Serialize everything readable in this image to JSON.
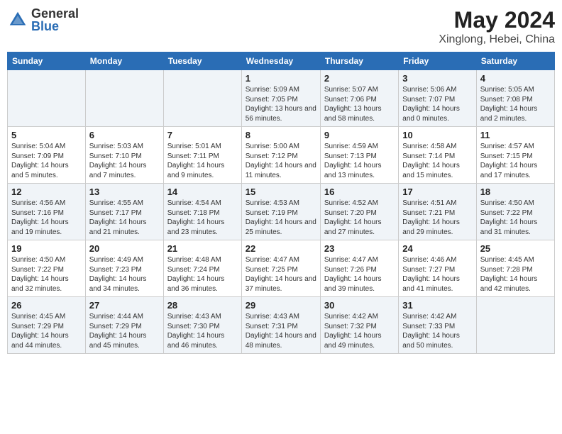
{
  "logo": {
    "general": "General",
    "blue": "Blue"
  },
  "header": {
    "month": "May 2024",
    "location": "Xinglong, Hebei, China"
  },
  "weekdays": [
    "Sunday",
    "Monday",
    "Tuesday",
    "Wednesday",
    "Thursday",
    "Friday",
    "Saturday"
  ],
  "weeks": [
    [
      {
        "day": "",
        "info": ""
      },
      {
        "day": "",
        "info": ""
      },
      {
        "day": "",
        "info": ""
      },
      {
        "day": "1",
        "info": "Sunrise: 5:09 AM\nSunset: 7:05 PM\nDaylight: 13 hours and 56 minutes."
      },
      {
        "day": "2",
        "info": "Sunrise: 5:07 AM\nSunset: 7:06 PM\nDaylight: 13 hours and 58 minutes."
      },
      {
        "day": "3",
        "info": "Sunrise: 5:06 AM\nSunset: 7:07 PM\nDaylight: 14 hours and 0 minutes."
      },
      {
        "day": "4",
        "info": "Sunrise: 5:05 AM\nSunset: 7:08 PM\nDaylight: 14 hours and 2 minutes."
      }
    ],
    [
      {
        "day": "5",
        "info": "Sunrise: 5:04 AM\nSunset: 7:09 PM\nDaylight: 14 hours and 5 minutes."
      },
      {
        "day": "6",
        "info": "Sunrise: 5:03 AM\nSunset: 7:10 PM\nDaylight: 14 hours and 7 minutes."
      },
      {
        "day": "7",
        "info": "Sunrise: 5:01 AM\nSunset: 7:11 PM\nDaylight: 14 hours and 9 minutes."
      },
      {
        "day": "8",
        "info": "Sunrise: 5:00 AM\nSunset: 7:12 PM\nDaylight: 14 hours and 11 minutes."
      },
      {
        "day": "9",
        "info": "Sunrise: 4:59 AM\nSunset: 7:13 PM\nDaylight: 14 hours and 13 minutes."
      },
      {
        "day": "10",
        "info": "Sunrise: 4:58 AM\nSunset: 7:14 PM\nDaylight: 14 hours and 15 minutes."
      },
      {
        "day": "11",
        "info": "Sunrise: 4:57 AM\nSunset: 7:15 PM\nDaylight: 14 hours and 17 minutes."
      }
    ],
    [
      {
        "day": "12",
        "info": "Sunrise: 4:56 AM\nSunset: 7:16 PM\nDaylight: 14 hours and 19 minutes."
      },
      {
        "day": "13",
        "info": "Sunrise: 4:55 AM\nSunset: 7:17 PM\nDaylight: 14 hours and 21 minutes."
      },
      {
        "day": "14",
        "info": "Sunrise: 4:54 AM\nSunset: 7:18 PM\nDaylight: 14 hours and 23 minutes."
      },
      {
        "day": "15",
        "info": "Sunrise: 4:53 AM\nSunset: 7:19 PM\nDaylight: 14 hours and 25 minutes."
      },
      {
        "day": "16",
        "info": "Sunrise: 4:52 AM\nSunset: 7:20 PM\nDaylight: 14 hours and 27 minutes."
      },
      {
        "day": "17",
        "info": "Sunrise: 4:51 AM\nSunset: 7:21 PM\nDaylight: 14 hours and 29 minutes."
      },
      {
        "day": "18",
        "info": "Sunrise: 4:50 AM\nSunset: 7:22 PM\nDaylight: 14 hours and 31 minutes."
      }
    ],
    [
      {
        "day": "19",
        "info": "Sunrise: 4:50 AM\nSunset: 7:22 PM\nDaylight: 14 hours and 32 minutes."
      },
      {
        "day": "20",
        "info": "Sunrise: 4:49 AM\nSunset: 7:23 PM\nDaylight: 14 hours and 34 minutes."
      },
      {
        "day": "21",
        "info": "Sunrise: 4:48 AM\nSunset: 7:24 PM\nDaylight: 14 hours and 36 minutes."
      },
      {
        "day": "22",
        "info": "Sunrise: 4:47 AM\nSunset: 7:25 PM\nDaylight: 14 hours and 37 minutes."
      },
      {
        "day": "23",
        "info": "Sunrise: 4:47 AM\nSunset: 7:26 PM\nDaylight: 14 hours and 39 minutes."
      },
      {
        "day": "24",
        "info": "Sunrise: 4:46 AM\nSunset: 7:27 PM\nDaylight: 14 hours and 41 minutes."
      },
      {
        "day": "25",
        "info": "Sunrise: 4:45 AM\nSunset: 7:28 PM\nDaylight: 14 hours and 42 minutes."
      }
    ],
    [
      {
        "day": "26",
        "info": "Sunrise: 4:45 AM\nSunset: 7:29 PM\nDaylight: 14 hours and 44 minutes."
      },
      {
        "day": "27",
        "info": "Sunrise: 4:44 AM\nSunset: 7:29 PM\nDaylight: 14 hours and 45 minutes."
      },
      {
        "day": "28",
        "info": "Sunrise: 4:43 AM\nSunset: 7:30 PM\nDaylight: 14 hours and 46 minutes."
      },
      {
        "day": "29",
        "info": "Sunrise: 4:43 AM\nSunset: 7:31 PM\nDaylight: 14 hours and 48 minutes."
      },
      {
        "day": "30",
        "info": "Sunrise: 4:42 AM\nSunset: 7:32 PM\nDaylight: 14 hours and 49 minutes."
      },
      {
        "day": "31",
        "info": "Sunrise: 4:42 AM\nSunset: 7:33 PM\nDaylight: 14 hours and 50 minutes."
      },
      {
        "day": "",
        "info": ""
      }
    ]
  ]
}
